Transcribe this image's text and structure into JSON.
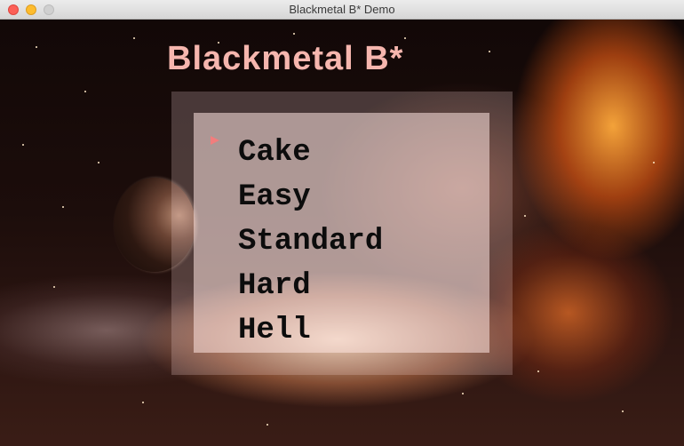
{
  "window": {
    "title": "Blackmetal B* Demo"
  },
  "game": {
    "title": "Blackmetal B*"
  },
  "menu": {
    "selected_index": 0,
    "items": [
      {
        "label": "Cake"
      },
      {
        "label": "Easy"
      },
      {
        "label": "Standard"
      },
      {
        "label": "Hard"
      },
      {
        "label": "Hell"
      }
    ]
  },
  "colors": {
    "title_text": "#f6b6ae",
    "cursor": "#f27d7d",
    "menu_text": "#0c0c0c"
  }
}
